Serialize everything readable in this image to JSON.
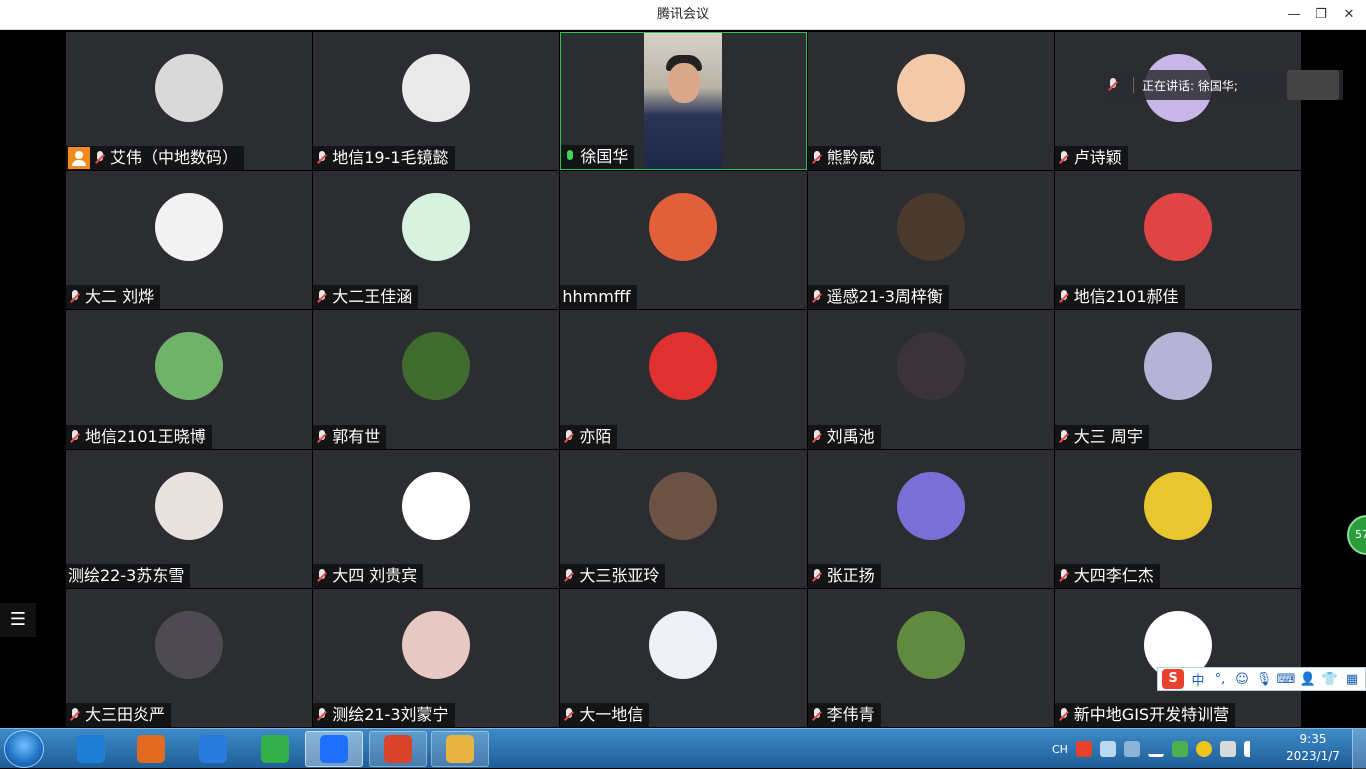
{
  "window": {
    "title": "腾讯会议",
    "minimize": "—",
    "restore": "❐",
    "close": "✕"
  },
  "speaking": {
    "label": "正在讲话: 徐国华;"
  },
  "participants": [
    {
      "name": "艾伟（中地数码）",
      "host": true,
      "mic": "muted",
      "avatar_color": "#d9d9d9"
    },
    {
      "name": "地信19-1毛镜懿",
      "mic": "muted",
      "avatar_color": "#eaeaea"
    },
    {
      "name": "徐国华",
      "mic": "on",
      "video": true
    },
    {
      "name": "熊黔威",
      "mic": "muted",
      "avatar_color": "#f3c9a8"
    },
    {
      "name": "卢诗颖",
      "mic": "muted",
      "avatar_color": "#c9b6e8"
    },
    {
      "name": "大二  刘烨",
      "mic": "muted",
      "avatar_color": "#f2f2f2"
    },
    {
      "name": "大二王佳涵",
      "mic": "muted",
      "avatar_color": "#d7f2de"
    },
    {
      "name": "hhmmfff",
      "mic": "none",
      "avatar_color": "#e0603a"
    },
    {
      "name": "遥感21-3周梓衡",
      "mic": "muted",
      "avatar_color": "#4a3a2e"
    },
    {
      "name": "地信2101郝佳",
      "mic": "muted",
      "avatar_color": "#e04444"
    },
    {
      "name": "地信2101王晓博",
      "mic": "muted",
      "avatar_color": "#6fb36a"
    },
    {
      "name": "郭有世",
      "mic": "muted",
      "avatar_color": "#3f6b2e"
    },
    {
      "name": "亦陌",
      "mic": "muted",
      "avatar_color": "#e03030"
    },
    {
      "name": "刘禹池",
      "mic": "muted",
      "avatar_color": "#3a3338"
    },
    {
      "name": "大三 周宇",
      "mic": "muted",
      "avatar_color": "#b7b3d6"
    },
    {
      "name": "测绘22-3苏东雪",
      "mic": "none",
      "avatar_color": "#e9e2de"
    },
    {
      "name": "大四 刘贵宾",
      "mic": "muted",
      "avatar_color": "#ffffff"
    },
    {
      "name": "大三张亚玲",
      "mic": "muted",
      "avatar_color": "#6b5244"
    },
    {
      "name": "张正扬",
      "mic": "muted",
      "avatar_color": "#7a6fd6"
    },
    {
      "name": "大四李仁杰",
      "mic": "muted",
      "avatar_color": "#e8c72e"
    },
    {
      "name": "大三田炎严",
      "mic": "muted",
      "avatar_color": "#4d4a52"
    },
    {
      "name": "测绘21-3刘蒙宁",
      "mic": "muted",
      "avatar_color": "#e8c8c2"
    },
    {
      "name": "大一地信",
      "mic": "muted",
      "avatar_color": "#eef2f8"
    },
    {
      "name": "李伟青",
      "mic": "muted",
      "avatar_color": "#5f8a3f"
    },
    {
      "name": "新中地GIS开发特训营",
      "mic": "muted",
      "avatar_color": "#ffffff"
    }
  ],
  "side": {
    "list_toggle_icon": "list-icon",
    "count_badge": "57"
  },
  "ime": {
    "logo": "S",
    "lang": "中",
    "punct": "°,"
  },
  "taskbar": {
    "apps": [
      {
        "id": "ie",
        "icon": "ie-icon",
        "color": "#1f7fd6",
        "state": "none"
      },
      {
        "id": "pdf",
        "icon": "pdf-icon",
        "color": "#e06a1f",
        "state": "none"
      },
      {
        "id": "sogou",
        "icon": "sogou-icon",
        "color": "#2a7be0",
        "state": "none"
      },
      {
        "id": "sync",
        "icon": "sync-icon",
        "color": "#34b04a",
        "state": "none"
      },
      {
        "id": "meeting",
        "icon": "tencent-meeting-icon",
        "color": "#1e6fff",
        "state": "focused"
      },
      {
        "id": "ppt",
        "icon": "presentation-icon",
        "color": "#d8432a",
        "state": "running"
      },
      {
        "id": "explorer",
        "icon": "folder-icon",
        "color": "#e8b441",
        "state": "running"
      }
    ],
    "tray_lang": "CH",
    "time": "9:35",
    "date": "2023/1/7"
  }
}
